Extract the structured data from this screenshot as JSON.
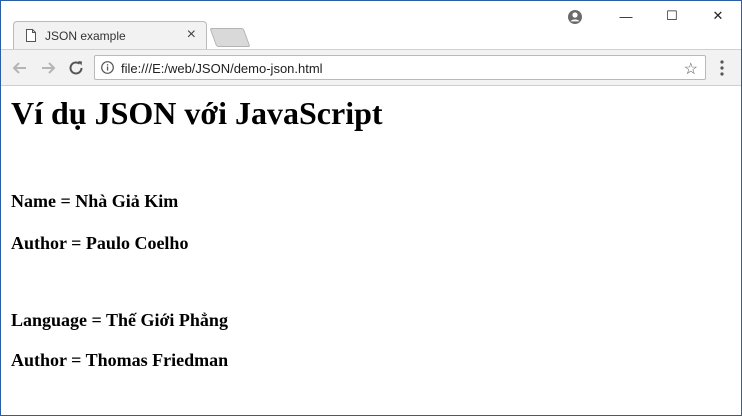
{
  "browser": {
    "tab": {
      "title": "JSON example",
      "close_label": "×"
    },
    "omnibox": {
      "url": "file:///E:/web/JSON/demo-json.html"
    },
    "window_controls": {
      "minimize": "—",
      "maximize": "☐",
      "close": "✕"
    }
  },
  "page": {
    "heading": "Ví dụ JSON với JavaScript",
    "lines": [
      "Name = Nhà Giả Kim",
      "Author = Paulo Coelho",
      "Language = Thế Giới Phẳng",
      "Author = Thomas Friedman"
    ]
  },
  "icons": {
    "tab": "document-icon",
    "profile": "profile-icon",
    "back": "back-arrow-icon",
    "forward": "forward-arrow-icon",
    "reload": "reload-icon",
    "info": "info-icon",
    "bookmark": "star-icon",
    "menu": "menu-dots-icon"
  },
  "colors": {
    "window_border": "#2a5fa8",
    "tab_bg": "#f2f2f2",
    "toolbar_bg": "#f2f2f2"
  }
}
